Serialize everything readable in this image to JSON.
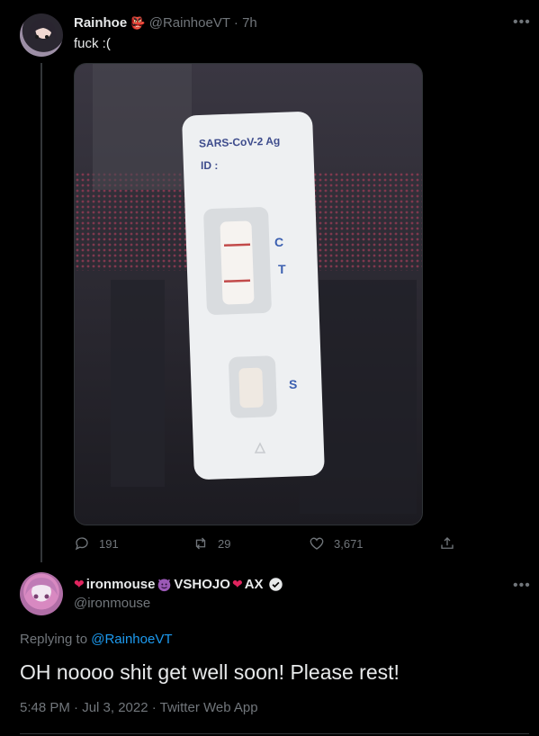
{
  "parent": {
    "name": "Rainhoe",
    "handle": "@RainhoeVT",
    "time": "7h",
    "text": "fuck :(",
    "emoji": "👺",
    "photo": {
      "cassette_label": "SARS-CoV-2 Ag",
      "cassette_id": "ID :",
      "mark_c": "C",
      "mark_t": "T",
      "mark_s": "S"
    },
    "replies": "191",
    "retweets": "29",
    "likes": "3,671"
  },
  "reply": {
    "name": "ironmouse",
    "name_suffix": "VSHOJO",
    "name_suffix2": "AX",
    "handle": "@ironmouse",
    "replying_label": "Replying to",
    "replying_handle": "@RainhoeVT",
    "text": "OH noooo shit get well soon! Please rest!",
    "meta": "5:48 PM · Jul 3, 2022 · Twitter Web App"
  },
  "colors": {
    "accent": "#1d9bf0",
    "muted": "#71767b",
    "text": "#e7e9ea",
    "background": "#000000"
  }
}
